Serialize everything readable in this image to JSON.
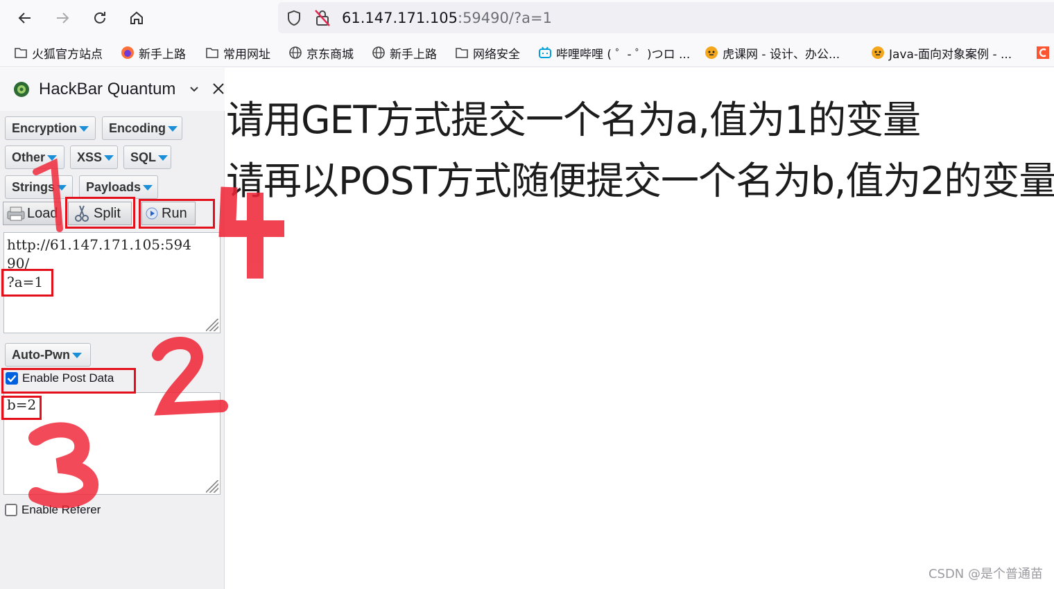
{
  "browser": {
    "url": {
      "host": "61.147.171.105",
      "rest": ":59490/?a=1"
    },
    "nav": {
      "back": "back-icon",
      "forward": "forward-icon",
      "reload": "reload-icon",
      "home": "home-icon"
    }
  },
  "bookmarks": [
    {
      "label": "火狐官方站点",
      "icon": "folder-icon"
    },
    {
      "label": "新手上路",
      "icon": "firefox-icon"
    },
    {
      "label": "常用网址",
      "icon": "folder-icon"
    },
    {
      "label": "京东商城",
      "icon": "globe-icon"
    },
    {
      "label": "新手上路",
      "icon": "globe-icon"
    },
    {
      "label": "网络安全",
      "icon": "folder-icon"
    },
    {
      "label": "哔哩哔哩 ( ゜- ゜)つロ ...",
      "icon": "bilibili-icon"
    },
    {
      "label": "虎课网 - 设计、办公...",
      "icon": "tiger-icon"
    },
    {
      "label": "Java-面向对象案例 - ...",
      "icon": "tiger-icon"
    }
  ],
  "hackbar": {
    "title": "HackBar Quantum",
    "menus": {
      "encryption": "Encryption",
      "encoding": "Encoding",
      "other": "Other",
      "xss": "XSS",
      "sql": "SQL",
      "strings": "Strings",
      "payloads": "Payloads",
      "autopwn": "Auto-Pwn"
    },
    "actions": {
      "load": "Load",
      "split": "Split",
      "run": "Run"
    },
    "url_lines": [
      "http://61.147.171.105:594",
      "90/",
      "?a=1"
    ],
    "enable_post": {
      "label": "Enable Post Data",
      "checked": true
    },
    "post_data": "b=2",
    "enable_referer": {
      "label": "Enable Referer",
      "checked": false
    }
  },
  "page": {
    "line1": "请用GET方式提交一个名为a,值为1的变量",
    "line2": "请再以POST方式随便提交一个名为b,值为2的变量"
  },
  "annotations": {
    "n1": "1",
    "n2": "2",
    "n3": "3",
    "n4": "4",
    "color": "#ef2233"
  },
  "watermark": "CSDN @是个普通苗"
}
